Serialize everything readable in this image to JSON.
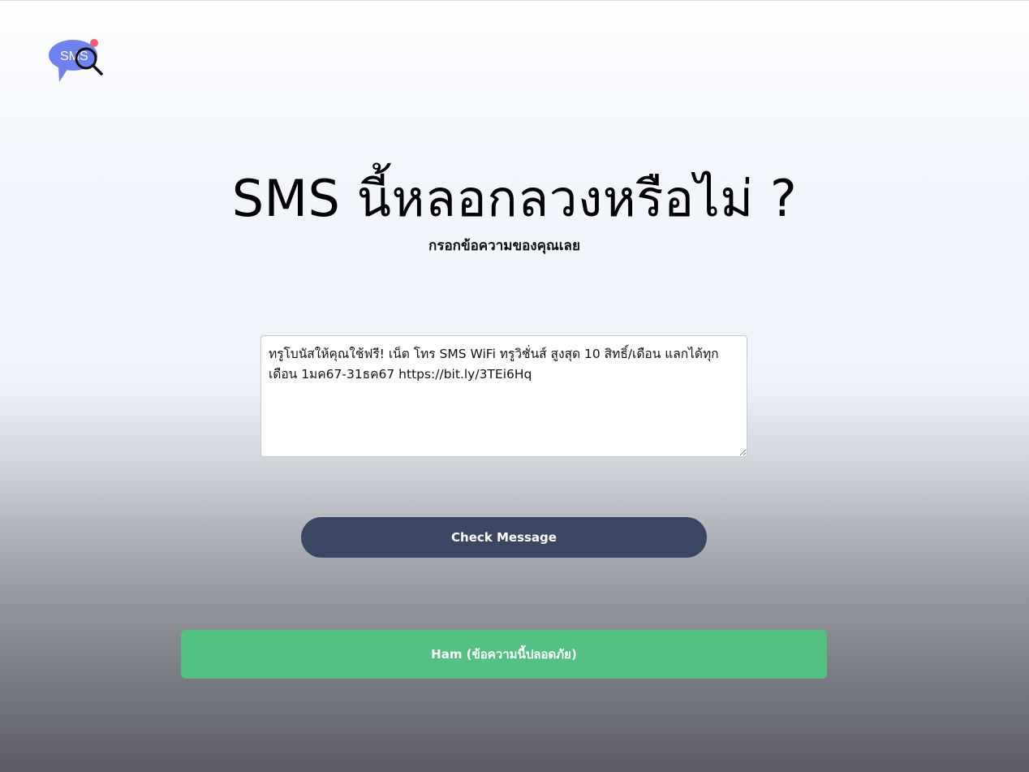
{
  "logo": {
    "text": "SMS",
    "icon": "magnifier-chat-bubble",
    "bubble_color": "#6e83f0",
    "dot_color": "#f25c6c"
  },
  "header": {
    "title": "SMS นี้หลอกลวงหรือไม่ ?",
    "subtitle": "กรอกข้อความของคุณเลย"
  },
  "form": {
    "message_value": "ทรูโบนัสให้คุณใช้ฟรี! เน็ต โทร SMS WiFi ทรูวิชั่นส์ สูงสุด 10 สิทธิ์/เดือน แลกได้ทุกเดือน 1มค67-31ธค67 https://bit.ly/3TEi6Hq",
    "check_button_label": "Check Message",
    "button_color": "#3a4763"
  },
  "result": {
    "label": "Ham (ข้อความนี้ปลอดภัย)",
    "color": "#52c080"
  }
}
